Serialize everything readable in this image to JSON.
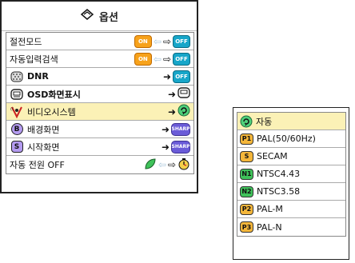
{
  "menu": {
    "title": "옵션",
    "title_icon": "options-icon",
    "items": [
      {
        "label": "절전모드",
        "left": "ON",
        "right": "OFF",
        "lead_icon": null
      },
      {
        "label": "자동입력검색",
        "left": "ON",
        "right": "OFF",
        "lead_icon": null
      },
      {
        "label": "DNR",
        "right": "OFF",
        "lead_icon": "dnr-icon"
      },
      {
        "label": "OSD화면표시",
        "right": "",
        "lead_icon": "osd-icon"
      },
      {
        "label": "비디오시스템",
        "right": "auto",
        "lead_icon": "video-system-icon",
        "selected": true
      },
      {
        "label": "배경화면",
        "right": "SHARP",
        "lead_icon": "background-icon",
        "lead_char": "B"
      },
      {
        "label": "시작화면",
        "right": "SHARP",
        "lead_icon": "startup-icon",
        "lead_char": "S"
      },
      {
        "label": "자동 전원 OFF",
        "lead_icon": null,
        "right": "timer"
      }
    ]
  },
  "submenu": {
    "options": [
      {
        "badge": "auto",
        "label": "자동",
        "selected": true
      },
      {
        "badge": "P1",
        "label": "PAL(50/60Hz)"
      },
      {
        "badge": "S",
        "label": "SECAM"
      },
      {
        "badge": "N1",
        "label": "NTSC4.43"
      },
      {
        "badge": "N2",
        "label": "NTSC3.58"
      },
      {
        "badge": "P2",
        "label": "PAL-M"
      },
      {
        "badge": "P3",
        "label": "PAL-N"
      }
    ]
  },
  "colors": {
    "highlight": "#fbf1b6",
    "on": "#f7a21b",
    "off": "#17a6c9",
    "sharp": "#6a5bd8"
  }
}
